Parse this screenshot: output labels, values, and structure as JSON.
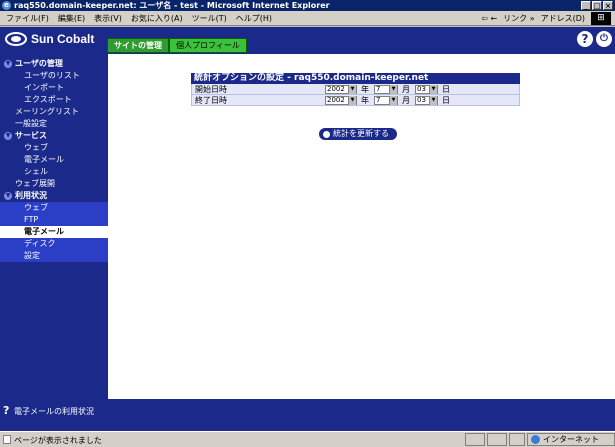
{
  "window": {
    "title": "raq550.domain-keeper.net: ユーザ名 - test - Microsoft Internet Explorer",
    "controls": [
      "_",
      "□",
      "×"
    ]
  },
  "menubar": {
    "items": [
      "ファイル(F)",
      "編集(E)",
      "表示(V)",
      "お気に入り(A)",
      "ツール(T)",
      "ヘルプ(H)"
    ],
    "back_label": "⇦ ←",
    "links_label": "リンク »",
    "address_label": "アドレス(D)"
  },
  "header": {
    "brand": "Sun Cobalt",
    "tabs": [
      {
        "label": "サイトの管理",
        "active": true
      },
      {
        "label": "個人プロフィール",
        "active": false
      }
    ],
    "help_glyph": "?",
    "close_glyph": "⏻"
  },
  "sidebar": {
    "items": [
      {
        "label": "ユーザの管理",
        "type": "sec",
        "icon": true
      },
      {
        "label": "ユーザのリスト",
        "type": "sub"
      },
      {
        "label": "インポート",
        "type": "sub"
      },
      {
        "label": "エクスポート",
        "type": "sub"
      },
      {
        "label": "メーリングリスト",
        "type": "plain"
      },
      {
        "label": "一般設定",
        "type": "plain"
      },
      {
        "label": "サービス",
        "type": "sec",
        "icon": true
      },
      {
        "label": "ウェブ",
        "type": "sub"
      },
      {
        "label": "電子メール",
        "type": "sub"
      },
      {
        "label": "シェル",
        "type": "sub"
      },
      {
        "label": "ウェブ展開",
        "type": "plain"
      },
      {
        "label": "利用状況",
        "type": "sec",
        "icon": true
      },
      {
        "label": "ウェブ",
        "type": "sub",
        "hl": true
      },
      {
        "label": "FTP",
        "type": "sub",
        "hl": true
      },
      {
        "label": "電子メール",
        "type": "sub",
        "active": true
      },
      {
        "label": "ディスク",
        "type": "sub",
        "hl": true
      },
      {
        "label": "設定",
        "type": "sub",
        "hl": true
      }
    ]
  },
  "panel": {
    "title": "統計オプションの設定 - raq550.domain-keeper.net",
    "rows": [
      {
        "label": "開始日時",
        "year": "2002",
        "month": "7",
        "day": "03"
      },
      {
        "label": "終了日時",
        "year": "2002",
        "month": "7",
        "day": "03"
      }
    ],
    "units": {
      "year": "年",
      "month": "月",
      "day": "日"
    },
    "update_button": "統計を更新する"
  },
  "footer": {
    "help_glyph": "?",
    "text": "電子メールの利用状況"
  },
  "statusbar": {
    "text": "ページが表示されました",
    "zone": "インターネット"
  },
  "colors": {
    "navy": "#1b2a8a",
    "tab_active": "#2f9c2f",
    "tab_inactive": "#3cc13c",
    "row_bg": "#e4e7f8"
  }
}
